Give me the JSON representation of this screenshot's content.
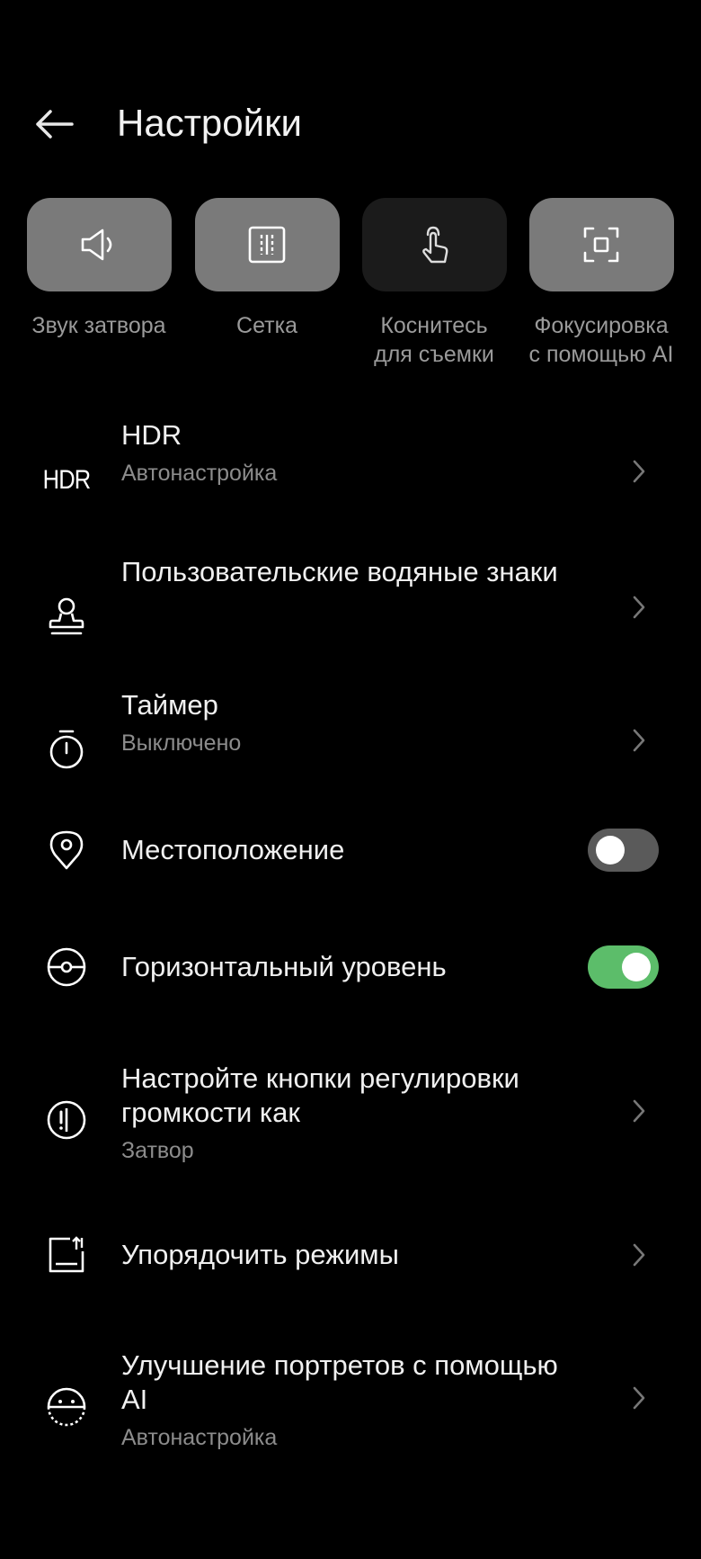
{
  "header": {
    "title": "Настройки",
    "back_icon": "arrow-left-icon"
  },
  "quick": [
    {
      "label": "Звук затвора",
      "icon": "speaker-icon",
      "active": true
    },
    {
      "label": "Сетка",
      "icon": "grid-icon",
      "active": true
    },
    {
      "label": "Коснитесь\nдля съемки",
      "icon": "touch-icon",
      "active": false
    },
    {
      "label": "Фокусировка\nс помощью AI",
      "icon": "focus-icon",
      "active": true
    }
  ],
  "rows": {
    "hdr": {
      "icon_text": "HDR",
      "title": "HDR",
      "sub": "Автонастройка"
    },
    "watermark": {
      "title": "Пользовательские водяные знаки"
    },
    "timer": {
      "title": "Таймер",
      "sub": "Выключено"
    },
    "location": {
      "title": "Местоположение",
      "toggle": false
    },
    "level": {
      "title": "Горизонтальный уровень",
      "toggle": true
    },
    "volume": {
      "title": "Настройте кнопки регулировки громкости как",
      "sub": "Затвор"
    },
    "modes": {
      "title": "Упорядочить режимы"
    },
    "portrait": {
      "title": "Улучшение портретов с помощью AI",
      "sub": "Автонастройка"
    }
  },
  "colors": {
    "background": "#000000",
    "tile_active": "#7a7a7a",
    "tile_inactive": "#1b1b1b",
    "toggle_on": "#5cbd6a",
    "toggle_off": "#5a5a5a"
  }
}
